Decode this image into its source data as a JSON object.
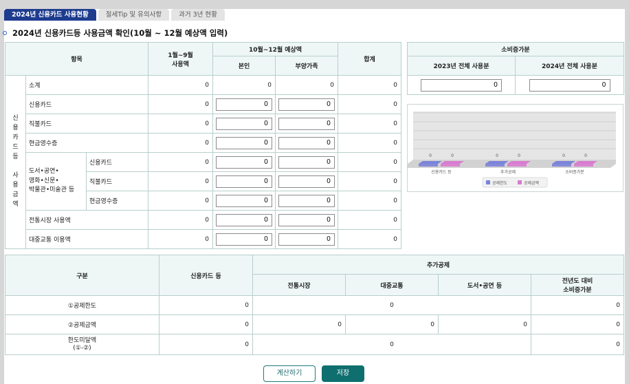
{
  "tabs": [
    {
      "label": "2024년 신용카드 사용현황",
      "active": true
    },
    {
      "label": "절세Tip 및 유의사항",
      "active": false
    },
    {
      "label": "과거 3년 현황",
      "active": false
    }
  ],
  "title": "2024년 신용카드등 사용금액 확인(10월 ~ 12월 예상액 입력)",
  "usage_table": {
    "headers": {
      "item": "항목",
      "jan_sep": "1월~9월\n사용액",
      "oct_dec": "10월~12월 예상액",
      "self": "본인",
      "dependents": "부양가족",
      "total": "합계"
    },
    "side_label": "신\n용\n카\n드\n등\n\n사\n용\n금\n액",
    "culture_label": "도서•공연•\n영화•신문•\n박물관•미술관 등",
    "rows": [
      {
        "label": "소계",
        "jan_sep": "0",
        "self": "0",
        "dep": "0",
        "total": "0"
      },
      {
        "label": "신용카드",
        "jan_sep": "0",
        "self": "0",
        "dep": "0",
        "total": "0"
      },
      {
        "label": "직불카드",
        "jan_sep": "0",
        "self": "0",
        "dep": "0",
        "total": "0"
      },
      {
        "label": "현금영수증",
        "jan_sep": "0",
        "self": "0",
        "dep": "0",
        "total": "0"
      },
      {
        "label": "신용카드",
        "jan_sep": "0",
        "self": "0",
        "dep": "0",
        "total": "0"
      },
      {
        "label": "직불카드",
        "jan_sep": "0",
        "self": "0",
        "dep": "0",
        "total": "0"
      },
      {
        "label": "현금영수증",
        "jan_sep": "0",
        "self": "0",
        "dep": "0",
        "total": "0"
      },
      {
        "label": "전통시장 사용액",
        "jan_sep": "0",
        "self": "0",
        "dep": "0",
        "total": "0"
      },
      {
        "label": "대중교통 이용액",
        "jan_sep": "0",
        "self": "0",
        "dep": "0",
        "total": "0"
      }
    ]
  },
  "increase_table": {
    "title": "소비증가분",
    "col2023": "2023년 전체 사용분",
    "col2024": "2024년 전체 사용분",
    "v2023": "0",
    "v2024": "0"
  },
  "chart_data": {
    "type": "bar",
    "categories": [
      "신용카드 등",
      "추가공제",
      "소비증가분"
    ],
    "series": [
      {
        "name": "공제한도",
        "values": [
          0,
          0,
          0
        ],
        "color": "#7b83d9"
      },
      {
        "name": "공제금액",
        "values": [
          0,
          0,
          0
        ],
        "color": "#d97bd0"
      }
    ],
    "data_labels": [
      "0",
      "0",
      "0",
      "0",
      "0",
      "0"
    ],
    "legend": "bottom-center",
    "grid": true
  },
  "deduction_table": {
    "headers": {
      "category": "구분",
      "credit": "신용카드 등",
      "extra": "추가공제",
      "market": "전통시장",
      "transit": "대중교통",
      "culture": "도서•공연 등",
      "increase": "전년도 대비\n소비증가분"
    },
    "row1": {
      "label": "①공제한도",
      "credit": "0",
      "extra": "0",
      "increase": "0"
    },
    "row2": {
      "label": "②공제금액",
      "credit": "0",
      "market": "0",
      "transit": "0",
      "culture": "0",
      "increase": "0"
    },
    "row3": {
      "label": "한도미달액\n(①-②)",
      "credit": "0",
      "extra": "0",
      "increase": "0"
    }
  },
  "buttons": {
    "calc": "계산하기",
    "save": "저장"
  }
}
